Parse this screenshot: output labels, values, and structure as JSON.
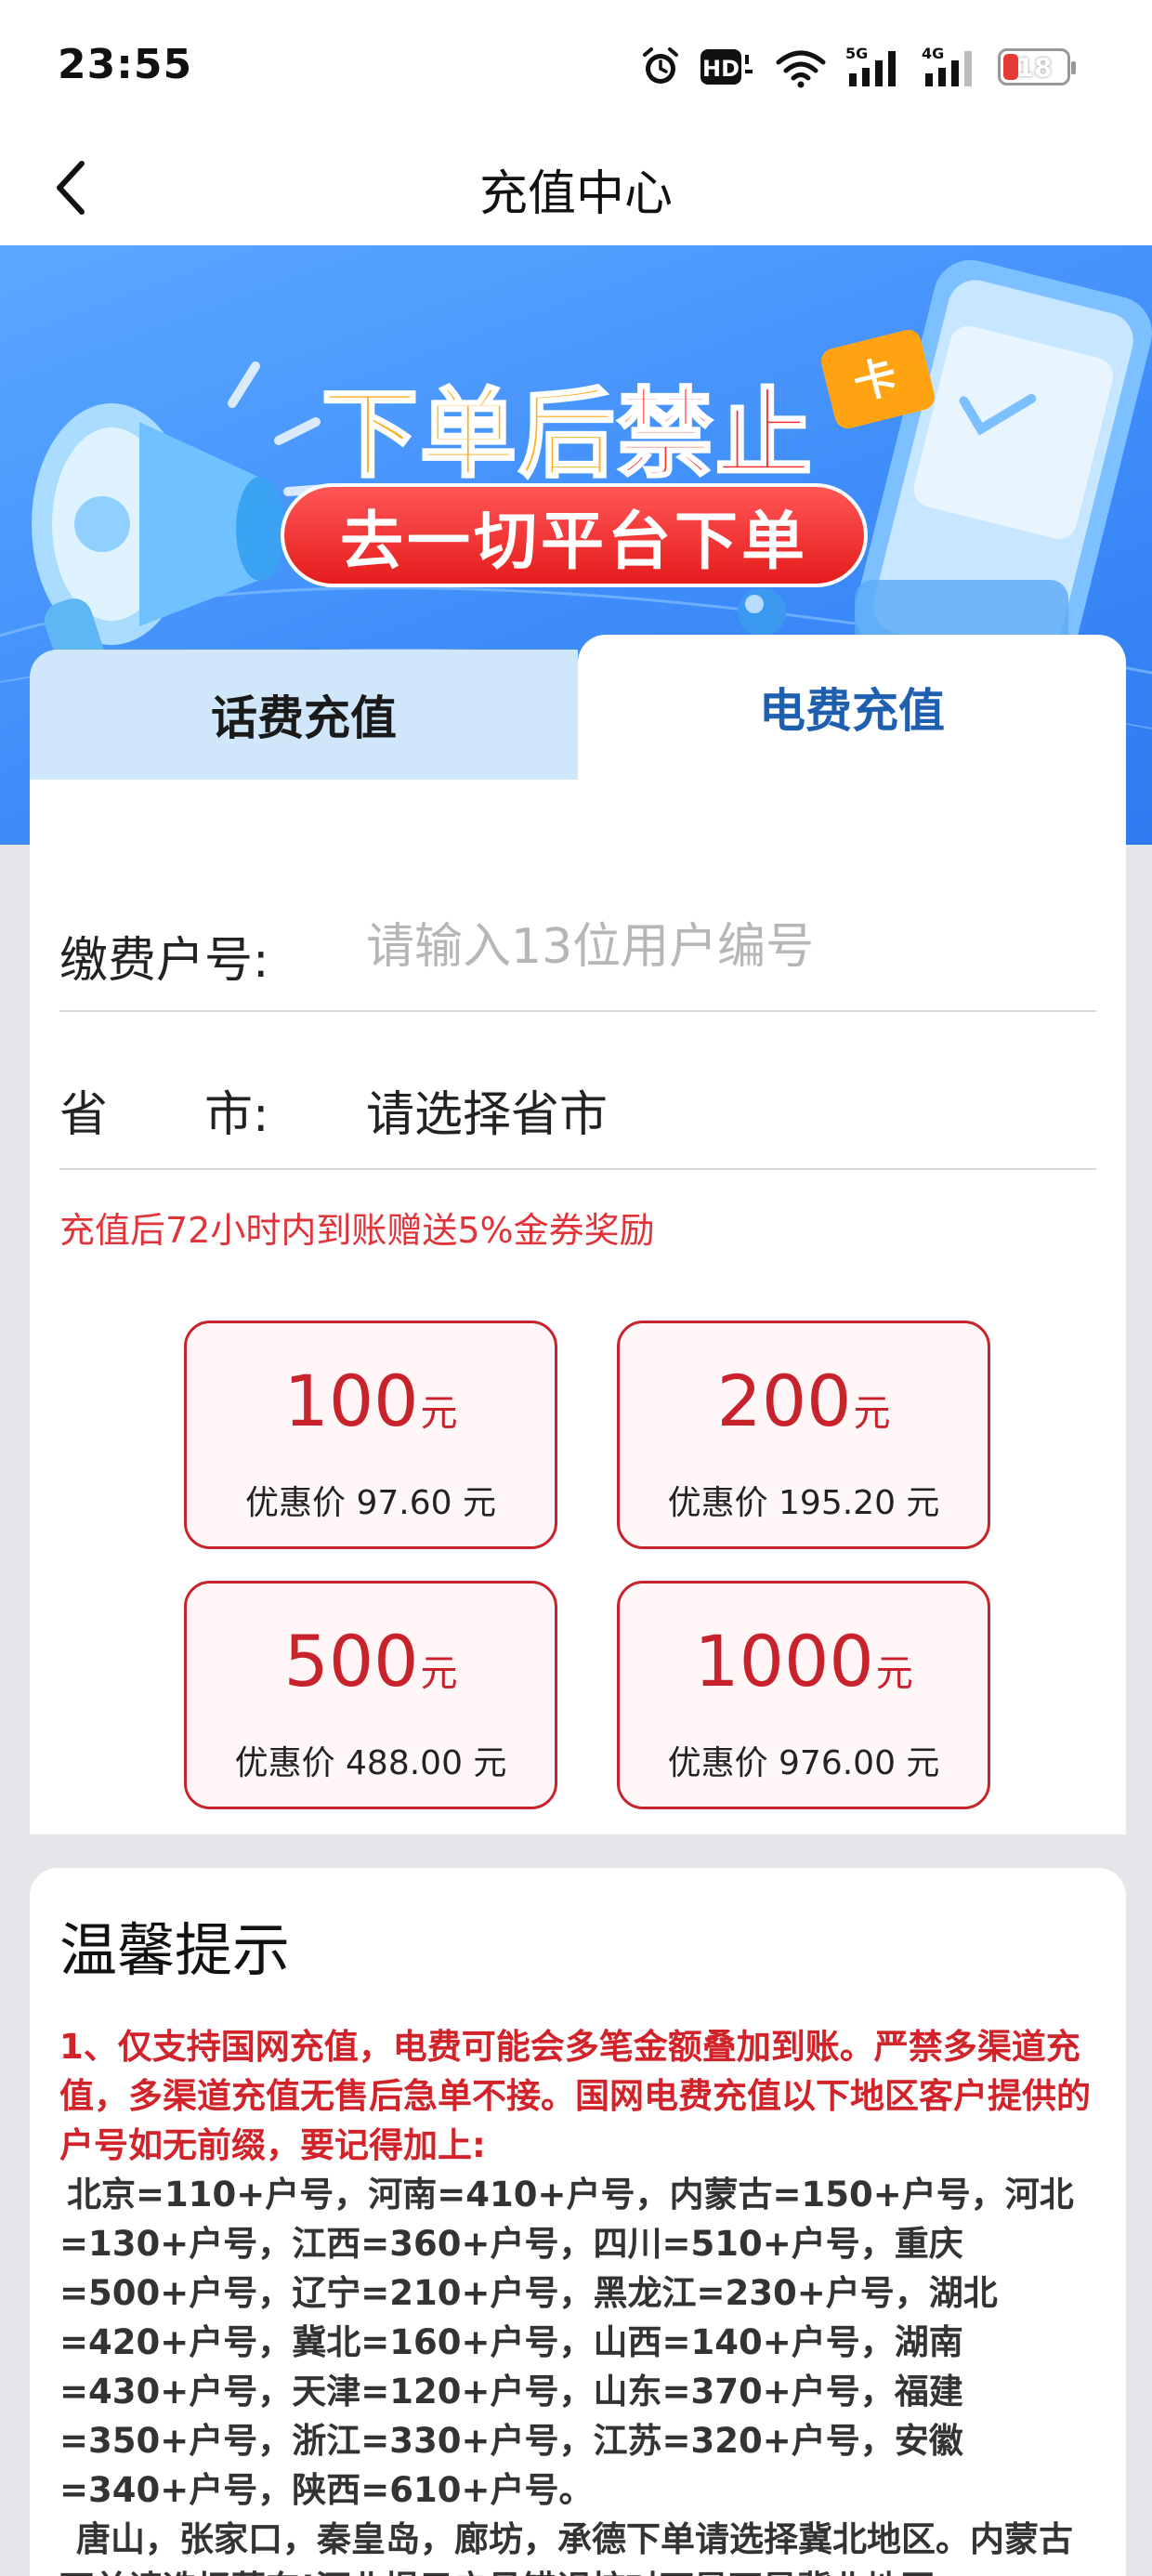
{
  "status_bar": {
    "time": "23:55",
    "hd_label": "HD",
    "net_5g": "5G",
    "net_4g": "4G",
    "battery": "18"
  },
  "nav": {
    "title": "充值中心"
  },
  "banner": {
    "line1_part1": "下单后",
    "line1_part2": "禁止",
    "line2": "去一切平台下单",
    "card_glyph": "卡"
  },
  "tabs": {
    "phone": "话费充值",
    "electric": "电费充值"
  },
  "form": {
    "account_label": "缴费户号:",
    "account_placeholder": "请输入13位用户编号",
    "region_label": "省　　市:",
    "region_value": "请选择省市",
    "promo": "充值后72小时内到账赠送5%金券奖励"
  },
  "amounts": [
    {
      "value": "100",
      "unit": "元",
      "price": "优惠价 97.60 元"
    },
    {
      "value": "200",
      "unit": "元",
      "price": "优惠价 195.20 元"
    },
    {
      "value": "500",
      "unit": "元",
      "price": "优惠价 488.00 元"
    },
    {
      "value": "1000",
      "unit": "元",
      "price": "优惠价 976.00 元"
    }
  ],
  "tips": {
    "title": "温馨提示",
    "red": "1、仅支持国网充值，电费可能会多笔金额叠加到账。严禁多渠道充值，多渠道充值无售后急单不接。国网电费充值以下地区客户提供的户号如无前缀，要记得加上:",
    "codes": "北京=110+户号，河南=410+户号，内蒙古=150+户号，河北=130+户号，江西=360+户号，四川=510+户号，重庆=500+户号，辽宁=210+户号，黑龙江=230+户号，湖北=420+户号，冀北=160+户号，山西=140+户号，湖南=430+户号，天津=120+户号，山东=370+户号，福建=350+户号，浙江=330+户号，江苏=320+户号，安徽=340+户号，陕西=610+户号。",
    "note": "唐山，张家口，秦皇岛，廊坊，承德下单请选择冀北地区。内蒙古下单请选择蒙东!河北提示户号错误核对下是不是冀北地区。"
  },
  "colors": {
    "accent_red": "#c8232c",
    "tab_active_text": "#1e5fb0",
    "banner_blue": "#3f8dfa"
  }
}
